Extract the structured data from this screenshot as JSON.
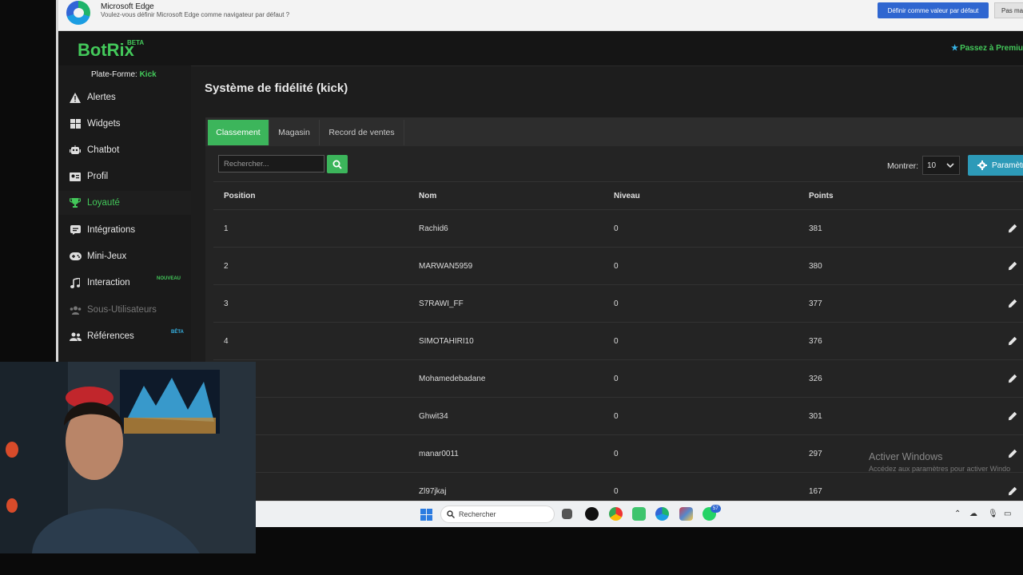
{
  "edge_bar": {
    "title": "Microsoft Edge",
    "subtitle": "Voulez-vous définir Microsoft Edge comme navigateur par défaut ?",
    "primary_button": "Définir comme valeur par défaut",
    "secondary_button": "Pas ma"
  },
  "app": {
    "logo": "BotRix",
    "logo_badge": "BETA",
    "premium": "Passez à Premiu",
    "platform_label": "Plate-Forme:",
    "platform_value": "Kick"
  },
  "sidebar": {
    "items": [
      {
        "label": "Alertes",
        "icon": "warning-icon"
      },
      {
        "label": "Widgets",
        "icon": "grid-icon"
      },
      {
        "label": "Chatbot",
        "icon": "robot-icon"
      },
      {
        "label": "Profil",
        "icon": "id-card-icon"
      },
      {
        "label": "Loyauté",
        "icon": "trophy-icon",
        "active": true
      },
      {
        "label": "Intégrations",
        "icon": "puzzle-icon"
      },
      {
        "label": "Mini-Jeux",
        "icon": "gamepad-icon"
      },
      {
        "label": "Interaction",
        "icon": "music-icon",
        "badge": "NOUVEAU"
      },
      {
        "label": "Sous-Utilisateurs",
        "icon": "users-icon",
        "disabled": true
      },
      {
        "label": "Références",
        "icon": "user-friends-icon",
        "badge": "BÊTA"
      }
    ]
  },
  "page": {
    "title": "Système de fidélité (kick)",
    "tabs": [
      "Classement",
      "Magasin",
      "Record de ventes"
    ],
    "active_tab": "Classement",
    "search_placeholder": "Rechercher...",
    "show_label": "Montrer:",
    "show_value": "10",
    "params_button": "Paramètres"
  },
  "table": {
    "columns": [
      "Position",
      "Nom",
      "Niveau",
      "Points"
    ],
    "rows": [
      {
        "position": "1",
        "name": "Rachid6",
        "level": "0",
        "points": "381"
      },
      {
        "position": "2",
        "name": "MARWAN5959",
        "level": "0",
        "points": "380"
      },
      {
        "position": "3",
        "name": "S7RAWI_FF",
        "level": "0",
        "points": "377"
      },
      {
        "position": "4",
        "name": "SIMOTAHIRI10",
        "level": "0",
        "points": "376"
      },
      {
        "position": "",
        "name": "Mohamedebadane",
        "level": "0",
        "points": "326"
      },
      {
        "position": "",
        "name": "Ghwit34",
        "level": "0",
        "points": "301"
      },
      {
        "position": "",
        "name": "manar0011",
        "level": "0",
        "points": "297"
      },
      {
        "position": "",
        "name": "Zl97jkaj",
        "level": "0",
        "points": "167"
      }
    ]
  },
  "watermark": {
    "title": "Activer Windows",
    "subtitle": "Accédez aux paramètres pour activer Windo"
  },
  "taskbar": {
    "search_placeholder": "Rechercher",
    "whatsapp_badge": "57"
  },
  "colors": {
    "brand_green": "#43c85a",
    "tab_active": "#3cb55b",
    "params_blue": "#2d9ab8",
    "edge_blue": "#2f66d0"
  }
}
